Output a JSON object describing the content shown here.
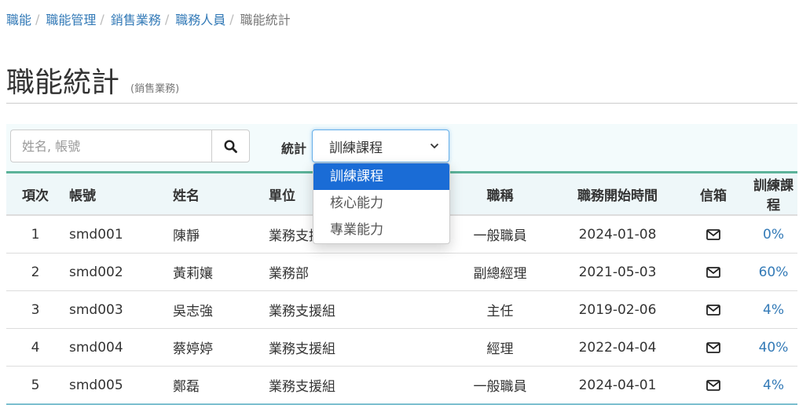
{
  "breadcrumb": {
    "items": [
      "職能",
      "職能管理",
      "銷售業務",
      "職務人員"
    ],
    "current": "職能統計",
    "separator": "/"
  },
  "header": {
    "title": "職能統計",
    "subtitle": "(銷售業務)"
  },
  "search": {
    "placeholder": "姓名, 帳號",
    "value": "",
    "icon": "search-icon"
  },
  "stat": {
    "label": "統計",
    "selected": "訓練課程",
    "options": [
      "訓練課程",
      "核心能力",
      "專業能力"
    ]
  },
  "table": {
    "headers": [
      "項次",
      "帳號",
      "姓名",
      "單位",
      "職稱",
      "職務開始時間",
      "信箱",
      "訓練課程"
    ],
    "rows": [
      [
        "1",
        "smd001",
        "陳靜",
        "業務支援組",
        "一般職員",
        "2024-01-08",
        "",
        "0%"
      ],
      [
        "2",
        "smd002",
        "黃莉孃",
        "業務部",
        "副總經理",
        "2021-05-03",
        "",
        "60%"
      ],
      [
        "3",
        "smd003",
        "吳志強",
        "業務支援組",
        "主任",
        "2019-02-06",
        "",
        "4%"
      ],
      [
        "4",
        "smd004",
        "蔡婷婷",
        "業務支援組",
        "經理",
        "2022-04-04",
        "",
        "40%"
      ],
      [
        "5",
        "smd005",
        "鄭磊",
        "業務支援組",
        "一般職員",
        "2024-04-01",
        "",
        "4%"
      ]
    ]
  },
  "colors": {
    "link": "#337ab7",
    "accent": "#5cb399",
    "selected_option": "#1a6cd6"
  }
}
